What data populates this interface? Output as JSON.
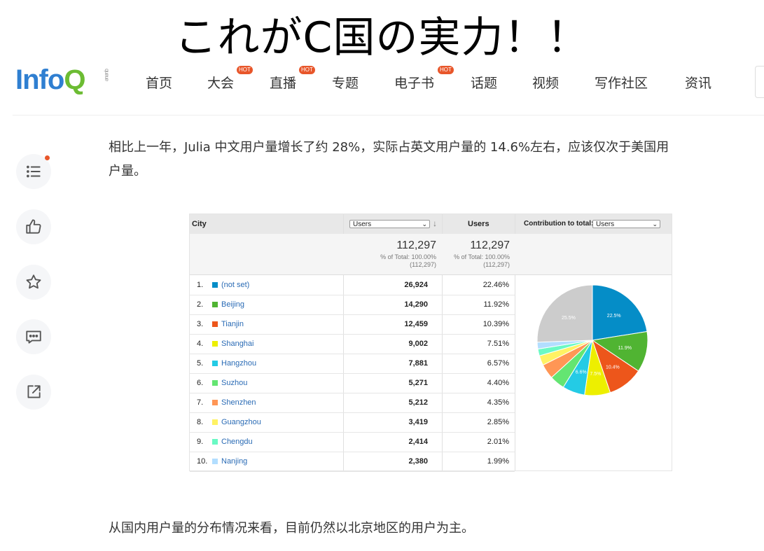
{
  "overlay_title": "これがC国の実力！！",
  "logo": {
    "part1": "Info",
    "part2": "Q",
    "small": "queue"
  },
  "nav": [
    {
      "label": "首页",
      "hot": ""
    },
    {
      "label": "大会",
      "hot": "HOT"
    },
    {
      "label": "直播",
      "hot": "HOT"
    },
    {
      "label": "专题",
      "hot": ""
    },
    {
      "label": "电子书",
      "hot": "HOT"
    },
    {
      "label": "话题",
      "hot": ""
    },
    {
      "label": "视频",
      "hot": ""
    },
    {
      "label": "写作社区",
      "hot": ""
    },
    {
      "label": "资讯",
      "hot": ""
    }
  ],
  "sidebar": [
    "list-icon",
    "thumbs-up-icon",
    "star-icon",
    "comment-icon",
    "share-icon"
  ],
  "article": {
    "para1_line1": "相比上一年，Julia 中文用户量增长了约 28%，实际占英文用户量的 14.6%左右，应该仅次于美国用",
    "para1_line2": "户量。",
    "para2": "从国内用户量的分布情况来看，目前仍然以北京地区的用户为主。"
  },
  "analytics": {
    "header": {
      "city": "City",
      "users_select": "Users",
      "users": "Users",
      "contribution": "Contribution to total:",
      "contribution_select": "Users"
    },
    "totals": {
      "value1": "112,297",
      "pct1": "% of Total: 100.00%",
      "abs1": "(112,297)",
      "value2": "112,297",
      "pct2": "% of Total: 100.00%",
      "abs2": "(112,297)"
    },
    "rows": [
      {
        "idx": "1.",
        "city": "(not set)",
        "users": "26,924",
        "pct": "22.46%",
        "color": "#058dc7"
      },
      {
        "idx": "2.",
        "city": "Beijing",
        "users": "14,290",
        "pct": "11.92%",
        "color": "#50b432"
      },
      {
        "idx": "3.",
        "city": "Tianjin",
        "users": "12,459",
        "pct": "10.39%",
        "color": "#ed561b"
      },
      {
        "idx": "4.",
        "city": "Shanghai",
        "users": "9,002",
        "pct": "7.51%",
        "color": "#edef00"
      },
      {
        "idx": "5.",
        "city": "Hangzhou",
        "users": "7,881",
        "pct": "6.57%",
        "color": "#24cbe5"
      },
      {
        "idx": "6.",
        "city": "Suzhou",
        "users": "5,271",
        "pct": "4.40%",
        "color": "#64e572"
      },
      {
        "idx": "7.",
        "city": "Shenzhen",
        "users": "5,212",
        "pct": "4.35%",
        "color": "#ff9655"
      },
      {
        "idx": "8.",
        "city": "Guangzhou",
        "users": "3,419",
        "pct": "2.85%",
        "color": "#fff263"
      },
      {
        "idx": "9.",
        "city": "Chengdu",
        "users": "2,414",
        "pct": "2.01%",
        "color": "#6af9c4"
      },
      {
        "idx": "10.",
        "city": "Nanjing",
        "users": "2,380",
        "pct": "1.99%",
        "color": "#b2deff"
      }
    ]
  },
  "chart_data": {
    "type": "pie",
    "categories": [
      "(not set)",
      "Beijing",
      "Tianjin",
      "Shanghai",
      "Hangzhou",
      "Suzhou",
      "Shenzhen",
      "Guangzhou",
      "Chengdu",
      "Nanjing",
      "Other"
    ],
    "values": [
      22.46,
      11.92,
      10.39,
      7.51,
      6.57,
      4.4,
      4.35,
      2.85,
      2.01,
      1.99,
      25.55
    ],
    "colors": [
      "#058dc7",
      "#50b432",
      "#ed561b",
      "#edef00",
      "#24cbe5",
      "#64e572",
      "#ff9655",
      "#fff263",
      "#6af9c4",
      "#b2deff",
      "#cccccc"
    ],
    "slice_labels": [
      "22.5%",
      "11.9%",
      "10.4%",
      "7.5%",
      "6.6%",
      "",
      "",
      "",
      "",
      "",
      "25.5%"
    ]
  }
}
